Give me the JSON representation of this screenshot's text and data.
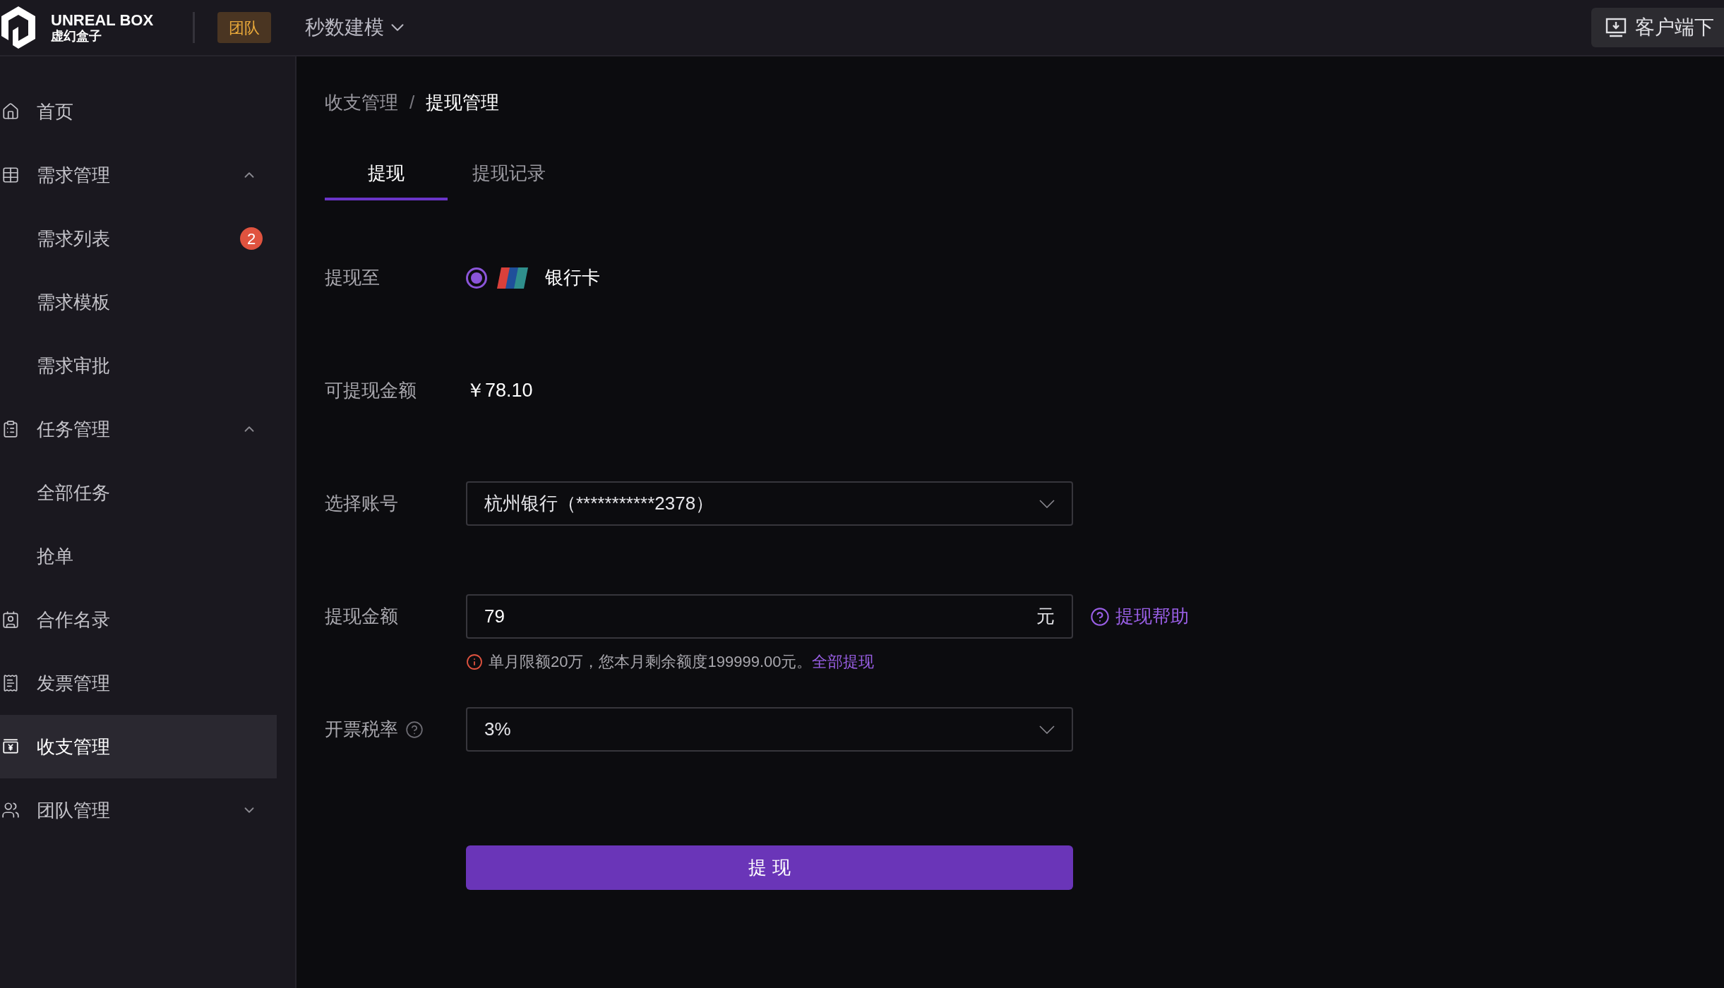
{
  "header": {
    "brand_title": "UNREAL BOX",
    "brand_subtitle": "虚幻盒子",
    "team_badge": "团队",
    "project_menu": "秒数建模",
    "client_button": "客户端下"
  },
  "sidebar": {
    "items": [
      {
        "label": "首页",
        "selected": false
      },
      {
        "label": "需求管理",
        "selected": false,
        "expanded": true,
        "children": [
          {
            "label": "需求列表",
            "selected": false,
            "badge": "2"
          },
          {
            "label": "需求模板",
            "selected": false
          },
          {
            "label": "需求审批",
            "selected": false
          }
        ]
      },
      {
        "label": "任务管理",
        "selected": false,
        "expanded": true,
        "children": [
          {
            "label": "全部任务",
            "selected": false
          },
          {
            "label": "抢单",
            "selected": false
          }
        ]
      },
      {
        "label": "合作名录",
        "selected": false
      },
      {
        "label": "发票管理",
        "selected": false
      },
      {
        "label": "收支管理",
        "selected": true
      },
      {
        "label": "团队管理",
        "selected": false,
        "expanded": false
      }
    ]
  },
  "breadcrumb": {
    "separator": "/",
    "items": [
      {
        "label": "收支管理",
        "current": false
      },
      {
        "label": "提现管理",
        "current": true
      }
    ]
  },
  "tabs": [
    {
      "label": "提现",
      "selected": true
    },
    {
      "label": "提现记录",
      "selected": false
    }
  ],
  "form": {
    "rows": [
      {
        "kind": "radio",
        "label": "提现至",
        "options": [
          {
            "label": "银行卡",
            "selected": true
          }
        ]
      },
      {
        "kind": "text",
        "label": "可提现金额",
        "value": "￥78.10"
      },
      {
        "kind": "select",
        "label": "选择账号",
        "value": "杭州银行（***********2378）"
      },
      {
        "kind": "amount",
        "label": "提现金额",
        "value": "79",
        "suffix": "元",
        "help_link": "提现帮助",
        "hint": "单月限额20万，您本月剩余额度199999.00元。",
        "hint_link": "全部提现"
      },
      {
        "kind": "select",
        "label": "开票税率",
        "help_icon": true,
        "value": "3%"
      }
    ],
    "submit": "提 现"
  }
}
